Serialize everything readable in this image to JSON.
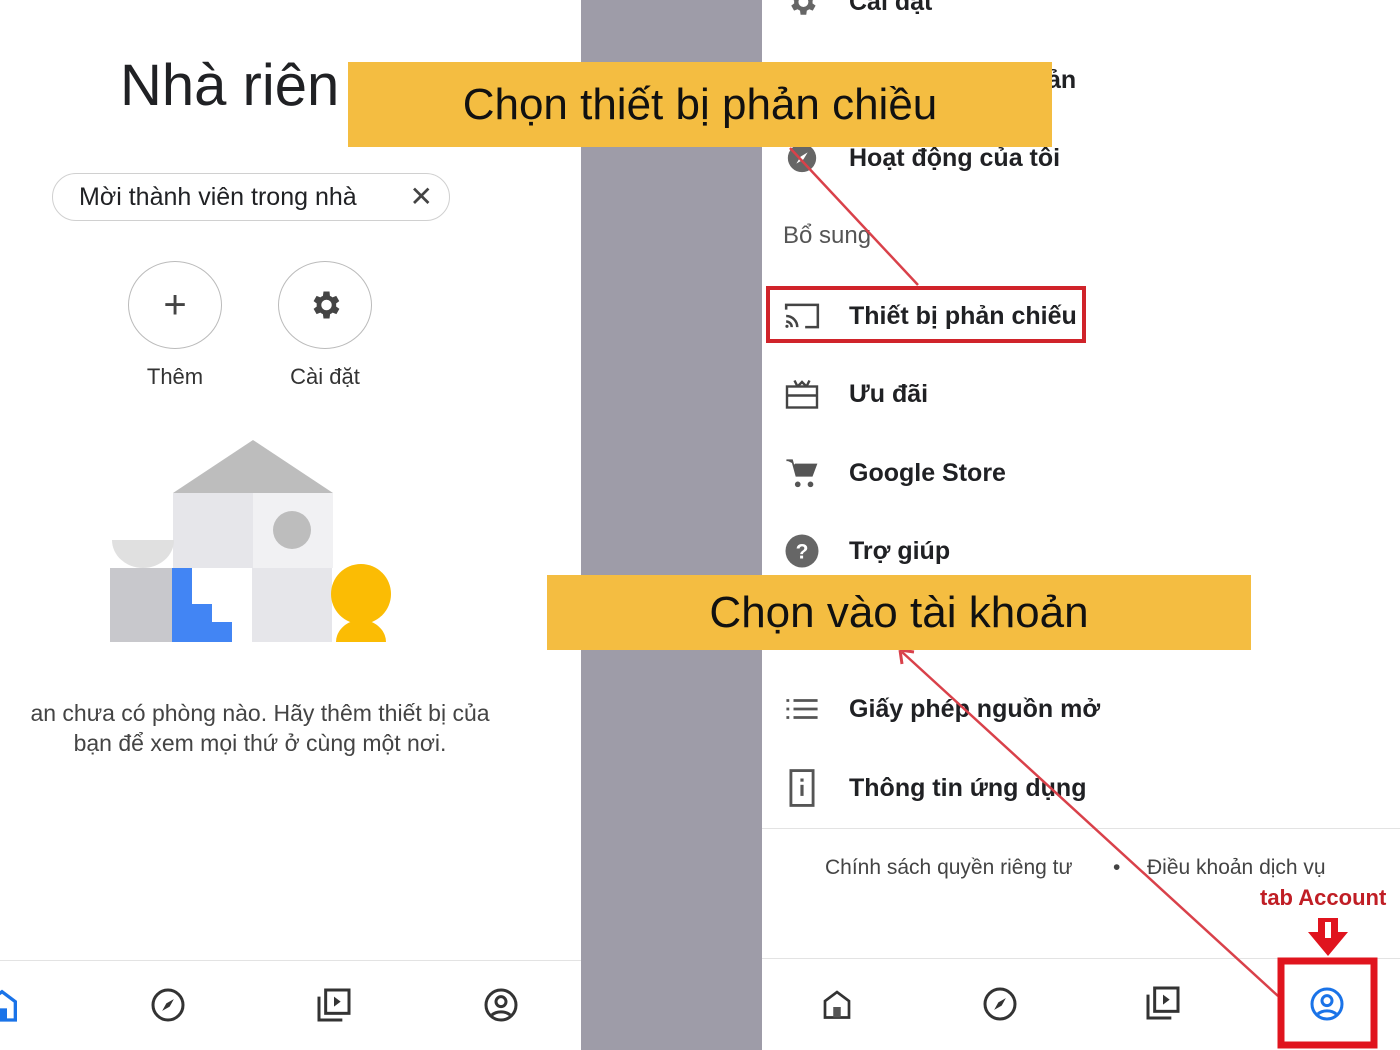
{
  "left": {
    "title": "Nhà riên",
    "invite_chip": {
      "label": "Mời thành viên trong nhà",
      "close": "✕"
    },
    "actions": [
      {
        "label": "Thêm",
        "icon": "plus-icon"
      },
      {
        "label": "Cài đặt",
        "icon": "gear-icon"
      }
    ],
    "empty_text_1": "an chưa có phòng nào. Hãy thêm thiết bị của",
    "empty_text_2": "bạn để xem mọi thứ ở cùng một nơi.",
    "nav": [
      "home-icon",
      "compass-icon",
      "media-icon",
      "account-icon"
    ]
  },
  "right": {
    "menu": [
      {
        "label": "Cài đặt",
        "icon": "gear-icon"
      },
      {
        "label": "ản",
        "icon": "account-icon"
      },
      {
        "label": "Hoạt động của tôi",
        "icon": "compass-icon"
      }
    ],
    "section": "Bổ sung",
    "extra": [
      {
        "label": "Thiết bị phản chiếu",
        "icon": "cast-icon"
      },
      {
        "label": "Ưu đãi",
        "icon": "gift-card-icon"
      },
      {
        "label": "Google Store",
        "icon": "cart-icon"
      },
      {
        "label": "Trợ giúp",
        "icon": "help-icon"
      },
      {
        "label": "Giấy phép nguồn mở",
        "icon": "list-icon"
      },
      {
        "label": "Thông tin ứng dụng",
        "icon": "info-icon"
      }
    ],
    "footer": {
      "privacy": "Chính sách quyền riêng tư",
      "dot": "•",
      "terms": "Điều khoản dịch vụ"
    },
    "nav": [
      "home-icon",
      "compass-icon",
      "media-icon",
      "account-icon"
    ]
  },
  "annotations": {
    "banner_top": "Chọn thiết bị phản chiều",
    "banner_bottom": "Chọn vào tài khoản",
    "tab_label": "tab Account",
    "highlight_color": "#d0232a",
    "banner_color": "#f4bd41",
    "active_tab_color": "#1a73e8"
  }
}
